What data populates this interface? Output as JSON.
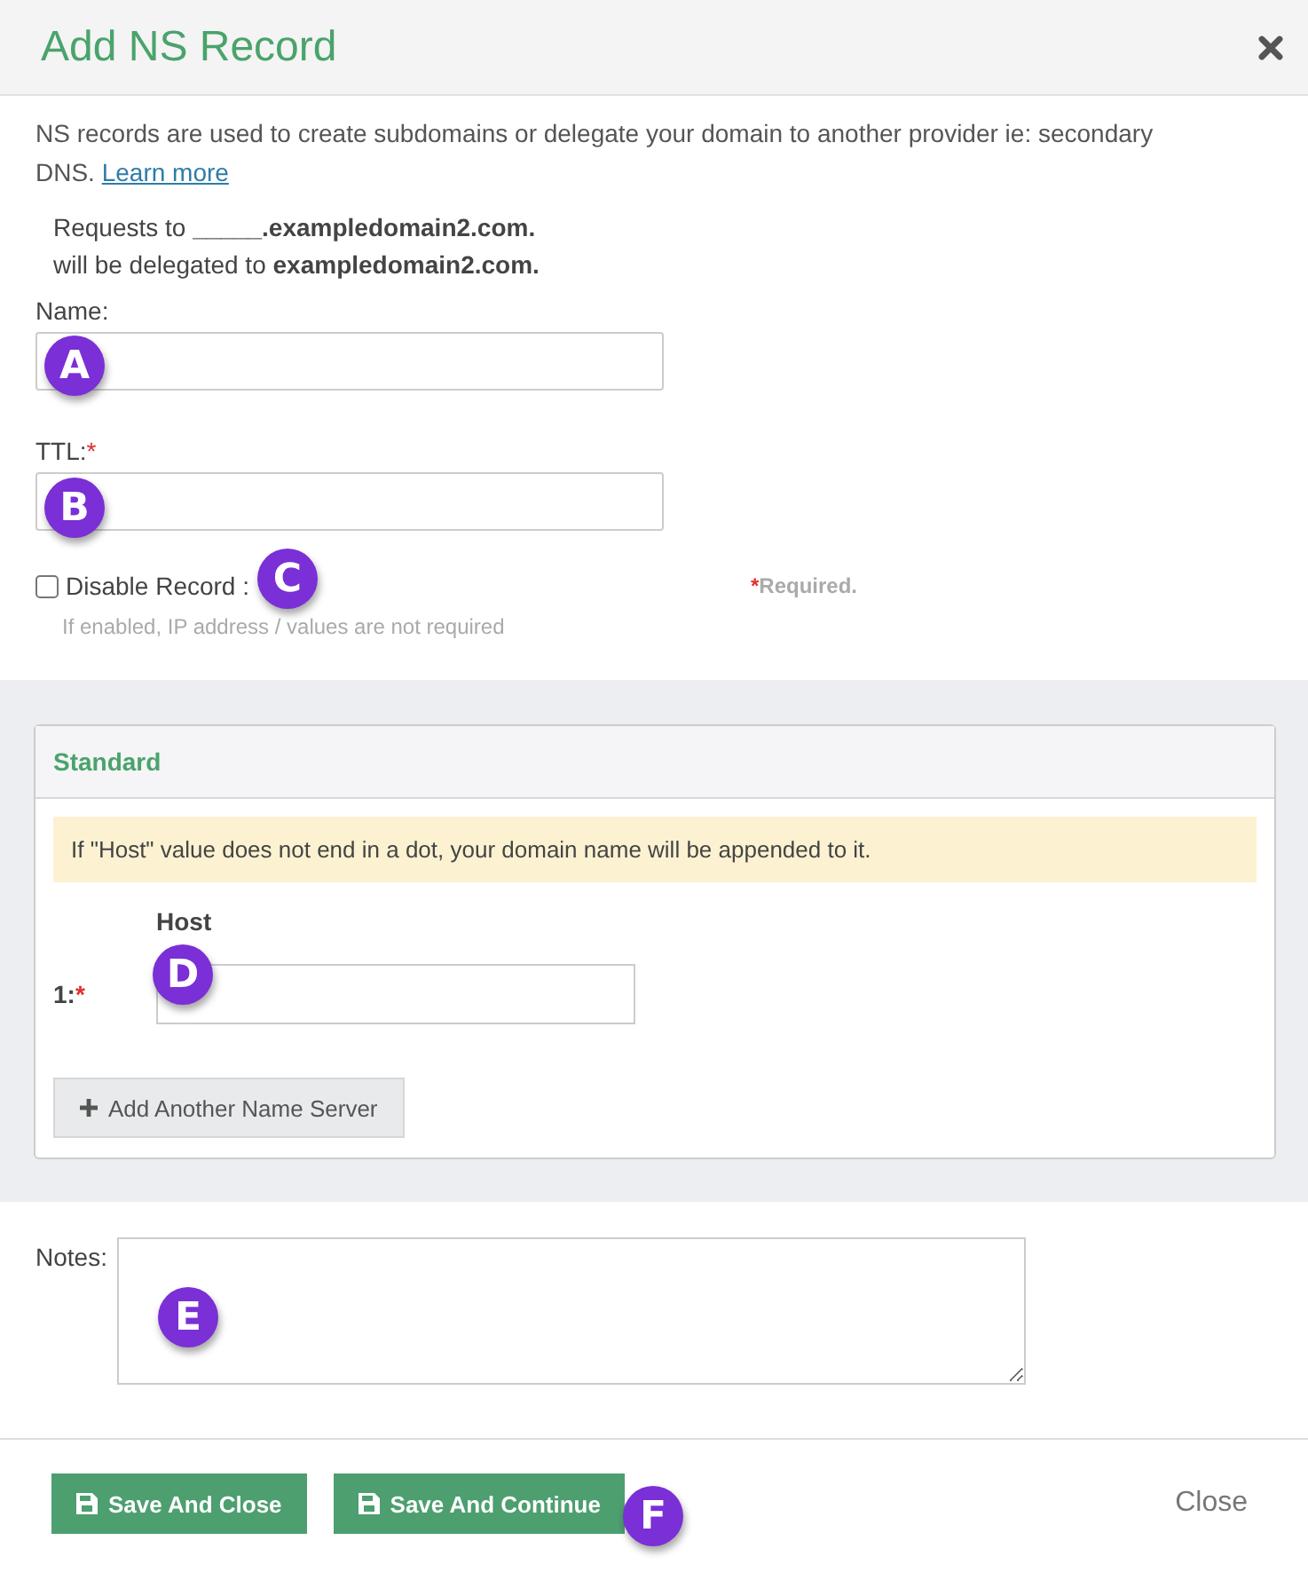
{
  "dialog": {
    "title": "Add NS Record"
  },
  "intro": {
    "text": "NS records are used to create subdomains or delegate your domain to another provider ie: secondary DNS.",
    "link": "Learn more"
  },
  "delegation": [
    "Requests to **_____.exampledomain2.com.**",
    "will be delegated to **exampledomain2.com.**"
  ],
  "fields": [
    {
      "label": "Name:",
      "required": false
    },
    {
      "label": "TTL:",
      "required": true
    }
  ],
  "disable_record": {
    "label": "Disable Record :",
    "checked": false,
    "hint": "If enabled, IP address / values are not required"
  },
  "required_note": {
    "mark": "*",
    "text": "Required."
  },
  "standard": {
    "title": "Standard",
    "notice": "If \"Host\" value does not end in a dot, your domain name will be appended to it.",
    "column": "Host",
    "rows": [
      {
        "label": "1:",
        "required": true
      }
    ],
    "add_button": "Add Another Name Server"
  },
  "notes": {
    "label": "Notes:"
  },
  "buttons": [
    {
      "label": "Save And Close"
    },
    {
      "label": "Save And Continue"
    }
  ],
  "close_link": "Close",
  "callouts": [
    {
      "label": "A"
    },
    {
      "label": "B"
    },
    {
      "label": "C"
    },
    {
      "label": "D"
    },
    {
      "label": "E"
    },
    {
      "label": "F"
    }
  ]
}
